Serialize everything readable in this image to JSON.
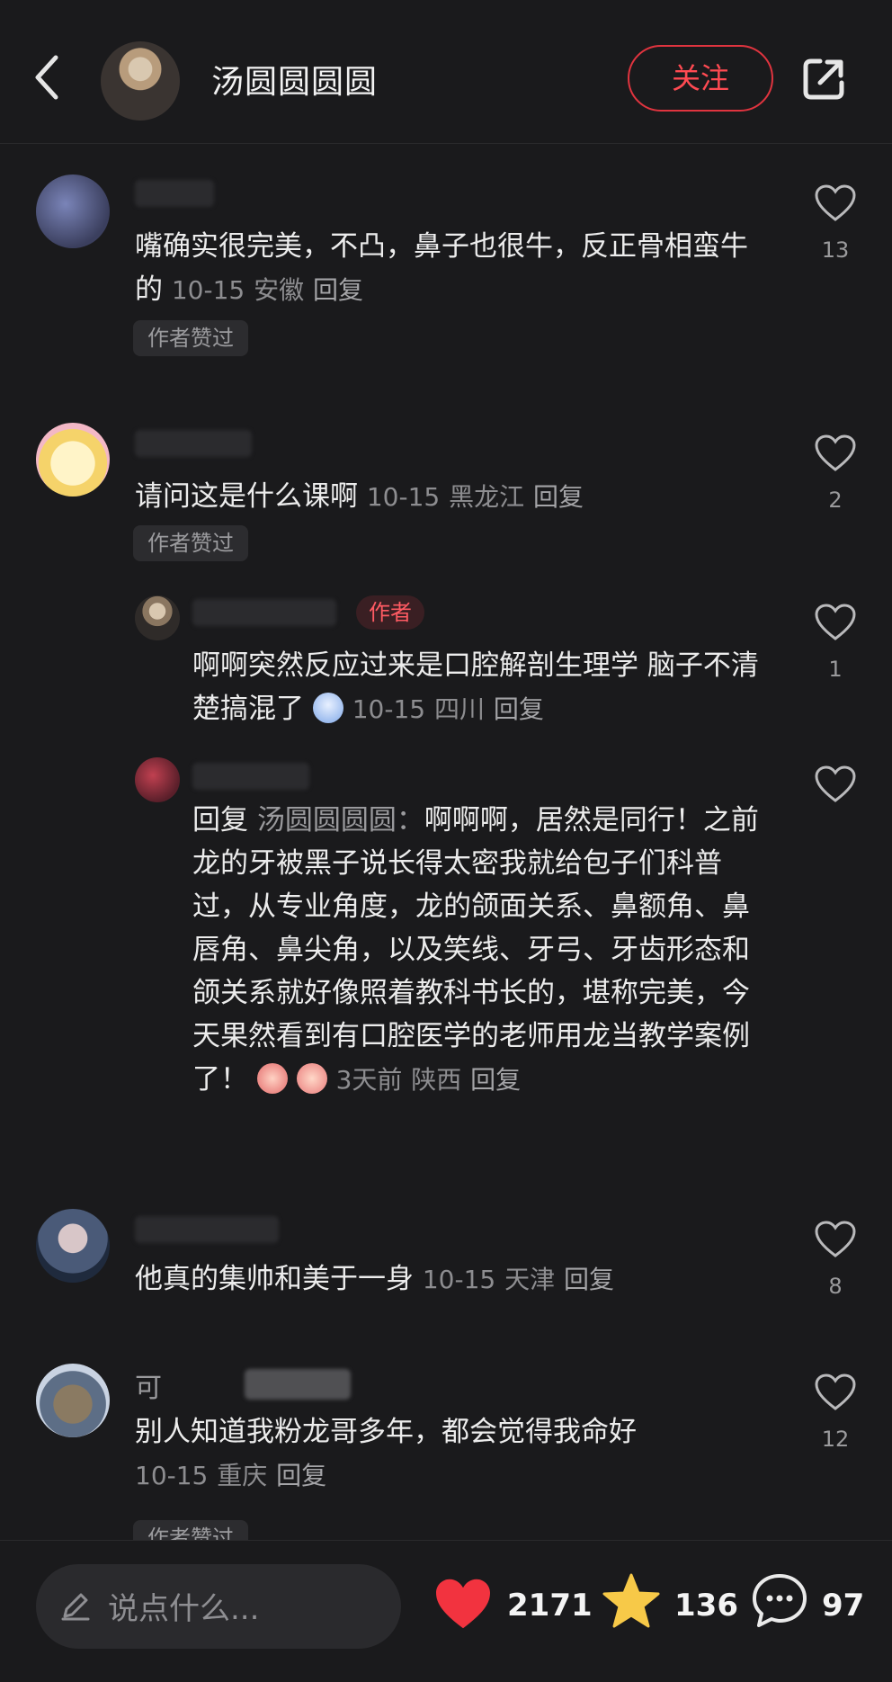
{
  "header": {
    "author_name": "汤圆圆圆圆",
    "follow_label": "关注"
  },
  "comments": [
    {
      "text": "嘴确实很完美，不凸，鼻子也很牛，反正骨相蛮牛的",
      "date": "10-15",
      "location": "安徽",
      "reply": "回复",
      "badge": "作者赞过",
      "likes": "13"
    },
    {
      "text": "请问这是什么课啊",
      "date": "10-15",
      "location": "黑龙江",
      "reply": "回复",
      "badge": "作者赞过",
      "likes": "2"
    },
    {
      "author_tag": "作者",
      "text": "啊啊突然反应过来是口腔解剖生理学 脑子不清楚搞混了",
      "date": "10-15",
      "location": "四川",
      "reply": "回复",
      "likes": "1"
    },
    {
      "reply_prefix": "回复",
      "quote_name": "汤圆圆圆圆：",
      "text": "啊啊啊，居然是同行！之前龙的牙被黑子说长得太密我就给包子们科普过，从专业角度，龙的颌面关系、鼻额角、鼻唇角、鼻尖角，以及笑线、牙弓、牙齿形态和颌关系就好像照着教科书长的，堪称完美，今天果然看到有口腔医学的老师用龙当教学案例了！",
      "date": "3天前",
      "location": "陕西",
      "reply": "回复",
      "likes": ""
    },
    {
      "text": "他真的集帅和美于一身",
      "date": "10-15",
      "location": "天津",
      "reply": "回复",
      "likes": "8"
    },
    {
      "name_partial": "可",
      "text": "别人知道我粉龙哥多年，都会觉得我命好",
      "date": "10-15",
      "location": "重庆",
      "reply": "回复",
      "badge": "作者赞过",
      "likes": "12"
    }
  ],
  "bottom_bar": {
    "input_placeholder": "说点什么...",
    "likes": "2171",
    "favorites": "136",
    "comments": "97"
  },
  "colors": {
    "background": "#1a1a1c",
    "accent_red": "#ff4a52",
    "star_yellow": "#f7c948"
  },
  "icons": [
    "back-arrow-icon",
    "share-icon",
    "heart-outline-icon",
    "pen-icon",
    "heart-filled-icon",
    "star-icon",
    "chat-bubble-icon"
  ]
}
